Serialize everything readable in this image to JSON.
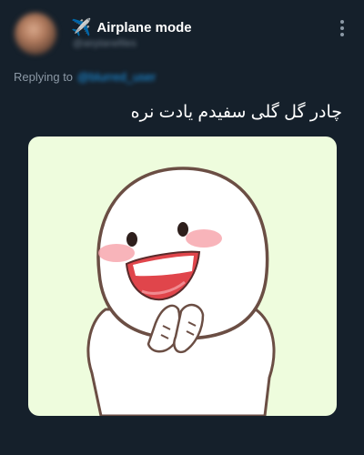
{
  "header": {
    "plane_icon": "airplane-icon",
    "display_name": "Airplane mode",
    "handle": "@airplanefiles",
    "more_icon": "more-vertical-icon"
  },
  "reply": {
    "prefix": "Replying to",
    "handle": "@blurred_user"
  },
  "tweet": {
    "text": "چادر گل گلی سفیدم یادت نره"
  },
  "media": {
    "type": "sticker",
    "background": "#eefcdd"
  }
}
